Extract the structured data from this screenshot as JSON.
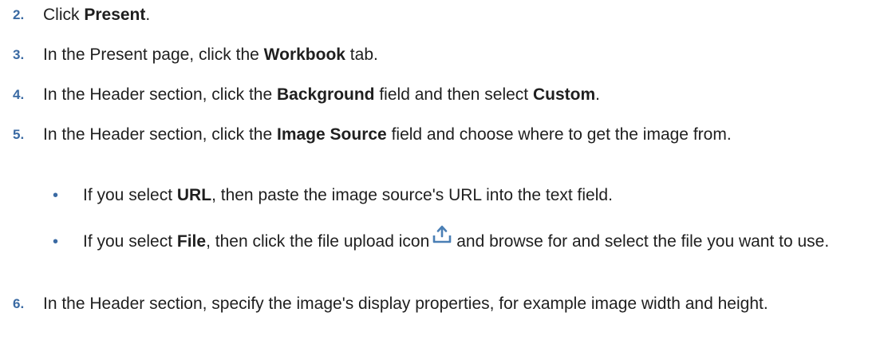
{
  "steps": [
    {
      "number": "2.",
      "parts": [
        {
          "t": "Click "
        },
        {
          "b": "Present"
        },
        {
          "t": "."
        }
      ]
    },
    {
      "number": "3.",
      "parts": [
        {
          "t": "In the Present page, click the "
        },
        {
          "b": "Workbook"
        },
        {
          "t": " tab."
        }
      ]
    },
    {
      "number": "4.",
      "parts": [
        {
          "t": "In the Header section, click the "
        },
        {
          "b": "Background"
        },
        {
          "t": " field and then select "
        },
        {
          "b": "Custom"
        },
        {
          "t": "."
        }
      ]
    },
    {
      "number": "5.",
      "parts": [
        {
          "t": "In the Header section, click the "
        },
        {
          "b": "Image Source"
        },
        {
          "t": " field and choose where to get the image from."
        }
      ],
      "bullets": [
        {
          "marker": "•",
          "parts": [
            {
              "t": "If you select "
            },
            {
              "b": "URL"
            },
            {
              "t": ", then paste the image source's URL into the text field."
            }
          ]
        },
        {
          "marker": "•",
          "parts": [
            {
              "t": "If you select "
            },
            {
              "b": "File"
            },
            {
              "t": ", then click the file upload icon"
            },
            {
              "icon": "upload-icon"
            },
            {
              "t": "and browse for and select the file you want to use."
            }
          ]
        }
      ]
    },
    {
      "number": "6.",
      "parts": [
        {
          "t": "In the Header section, specify the image's display properties, for example image width and height."
        }
      ]
    }
  ]
}
